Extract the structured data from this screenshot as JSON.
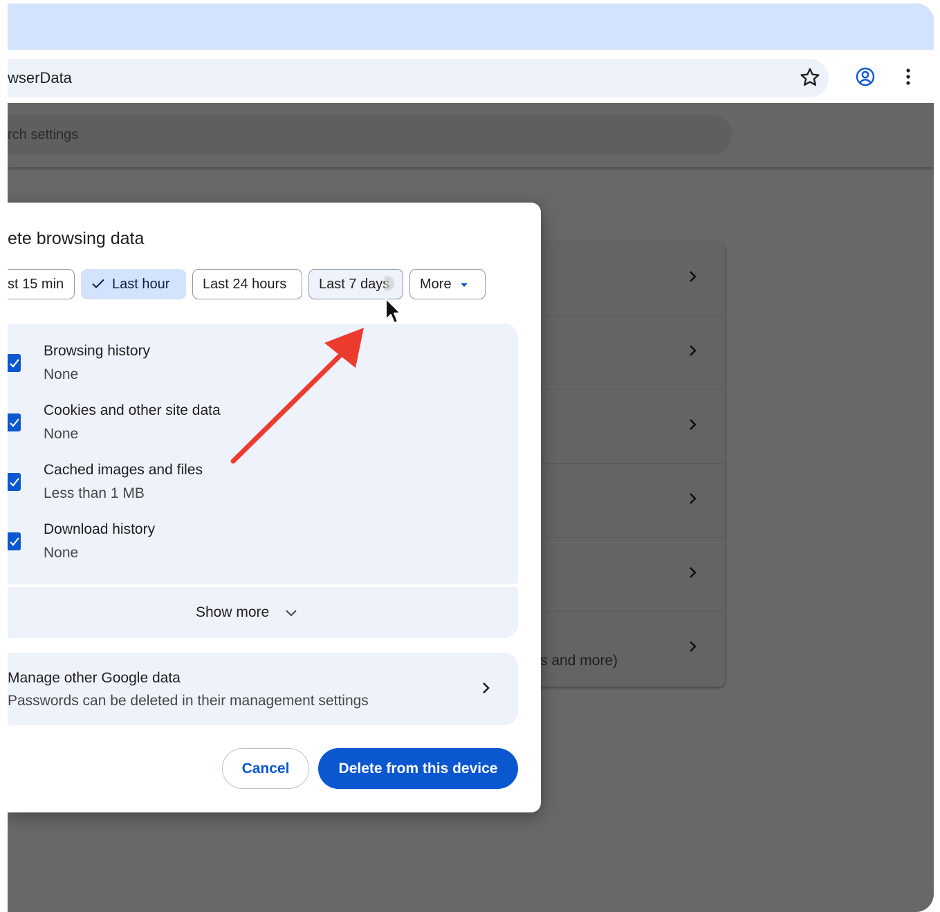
{
  "toolbar": {
    "address_text": "wserData",
    "icons": [
      "star-icon",
      "profile-icon",
      "more-vert-icon"
    ]
  },
  "settings": {
    "search_placeholder": "rch settings",
    "bg_row_partial_text": "s and more)"
  },
  "dialog": {
    "title": "ete browsing data",
    "time_ranges": [
      {
        "label": "st 15 min",
        "selected": false
      },
      {
        "label": "Last hour",
        "selected": true
      },
      {
        "label": "Last 24 hours",
        "selected": false
      },
      {
        "label": "Last 7 days",
        "selected": false
      },
      {
        "label": "More",
        "selected": false
      }
    ],
    "items": [
      {
        "title": "Browsing history",
        "detail": "None",
        "checked": true
      },
      {
        "title": "Cookies and other site data",
        "detail": "None",
        "checked": true
      },
      {
        "title": "Cached images and files",
        "detail": "Less than 1 MB",
        "checked": true
      },
      {
        "title": "Download history",
        "detail": "None",
        "checked": true
      }
    ],
    "show_more_label": "Show more",
    "manage": {
      "title": "Manage other Google data",
      "subtitle": "Passwords can be deleted in their management settings"
    },
    "cancel_label": "Cancel",
    "delete_label": "Delete from this device"
  },
  "colors": {
    "accent": "#0b57d0",
    "chip_selected": "#d3e3fd",
    "panel": "#eef2fa",
    "annotation_arrow": "#ee3b2f"
  }
}
